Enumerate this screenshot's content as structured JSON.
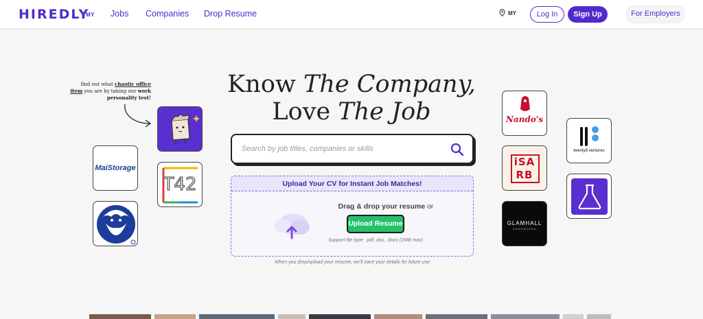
{
  "header": {
    "logo": "HIREDLY",
    "logo_suffix": "MY",
    "nav": [
      {
        "label": "Jobs"
      },
      {
        "label": "Companies"
      },
      {
        "label": "Drop Resume"
      }
    ],
    "country": "MY",
    "login_label": "Log In",
    "signup_label": "Sign Up",
    "employers_label": "For Employers"
  },
  "hero": {
    "title_line1_plain": "Know ",
    "title_line1_italic": "The Company,",
    "title_line2_plain": "Love ",
    "title_line2_italic": "The Job"
  },
  "search": {
    "placeholder": "Search by job titles, companies or skills"
  },
  "upload": {
    "header": "Upload Your CV for Instant Job Matches!",
    "drag_bold": "Drag & drop your resume",
    "drag_or": " or",
    "button_label": "Upload Resume",
    "support": "Support file type: .pdf, doc, .docx (2MB max)",
    "save_note": "When you drop/upload your resume, we'll save your details for future use"
  },
  "personality_note": {
    "part1": "find out what ",
    "link": "chaotic office item",
    "part2": " you are by taking our ",
    "bold": "work personality test!"
  },
  "tiles": {
    "maistorage": "MaiStorage",
    "t42": "T42",
    "nandos": "Nando's",
    "isarb_line1": "iSA",
    "isarb_line2": "RB",
    "glamhall": "GLAMHALL",
    "glamhall_sub": "DAMANSARA",
    "twenty8": "twenty8 ventures"
  },
  "colors": {
    "brand": "#512acc",
    "upload_green": "#23c16b",
    "nandos_red": "#c8102e"
  }
}
